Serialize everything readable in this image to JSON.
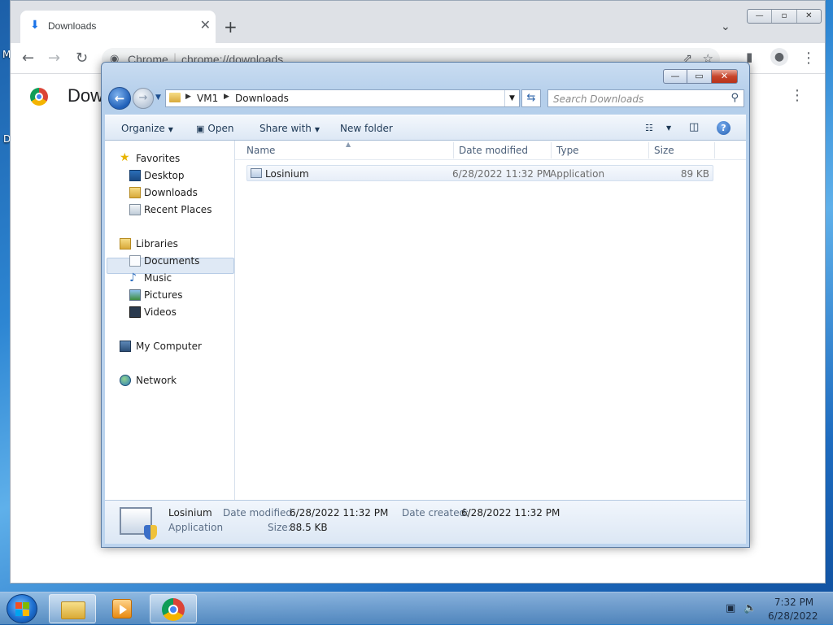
{
  "desktop": {
    "left_fragment_top": "M",
    "left_fragment_mid": "D"
  },
  "chrome": {
    "tab_title": "Downloads",
    "tab_close": "✕",
    "new_tab": "+",
    "tab_search": "⌄",
    "window_buttons": [
      "—",
      "▫",
      "✕"
    ],
    "omnibox_site": "Chrome",
    "omnibox_url": "chrome://downloads",
    "page_title": "Dow",
    "page_menu": "⋮"
  },
  "explorer": {
    "window_buttons": [
      "—",
      "▭",
      "✕"
    ],
    "breadcrumb": [
      "VM1",
      "Downloads"
    ],
    "search_placeholder": "Search Downloads",
    "commands": {
      "organize": "Organize",
      "open": "Open",
      "share_with": "Share with",
      "new_folder": "New folder"
    },
    "nav_pane": {
      "favorites": "Favorites",
      "favorites_items": [
        "Desktop",
        "Downloads",
        "Recent Places"
      ],
      "libraries": "Libraries",
      "libraries_items": [
        "Documents",
        "Music",
        "Pictures",
        "Videos"
      ],
      "computer": "My Computer",
      "network": "Network",
      "selected": "Downloads"
    },
    "columns": [
      "Name",
      "Date modified",
      "Type",
      "Size"
    ],
    "files": [
      {
        "name": "Losinium",
        "date_modified": "6/28/2022 11:32 PM",
        "type": "Application",
        "size": "89 KB"
      }
    ],
    "details": {
      "name": "Losinium",
      "type": "Application",
      "date_modified_label": "Date modified:",
      "date_modified": "6/28/2022 11:32 PM",
      "date_created_label": "Date created:",
      "date_created": "6/28/2022 11:32 PM",
      "size_label": "Size:",
      "size": "88.5 KB"
    }
  },
  "taskbar": {
    "time": "7:32 PM",
    "date": "6/28/2022"
  }
}
